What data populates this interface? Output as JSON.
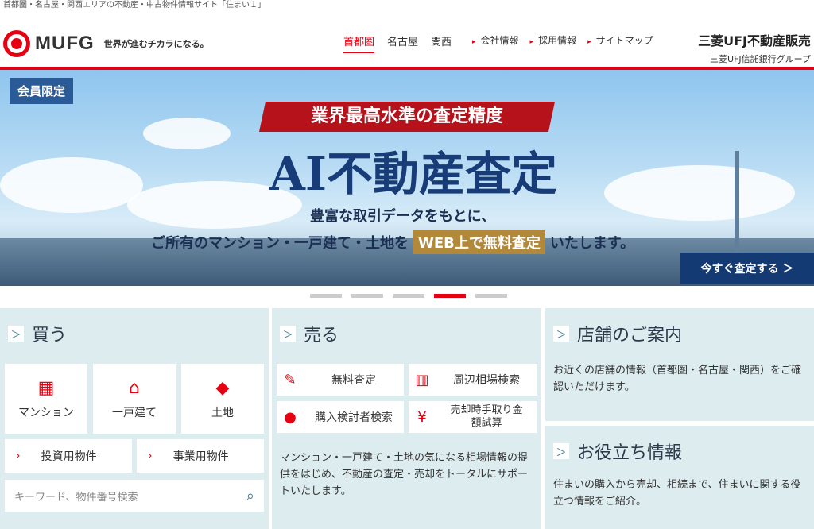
{
  "tagline": "首都圏・名古屋・関西エリアの不動産・中古物件情報サイト「住まい１」",
  "brand": {
    "logo": "MUFG",
    "slogan": "世界が進むチカラになる。"
  },
  "nav": {
    "areas": [
      "首都圏",
      "名古屋",
      "関西"
    ],
    "links": [
      "会社情報",
      "採用情報",
      "サイトマップ"
    ]
  },
  "corp": {
    "name": "三菱UFJ不動産販売",
    "group": "三菱UFJ信託銀行グループ"
  },
  "hero": {
    "badge": "会員限定",
    "ribbon": "業界最高水準の査定精度",
    "headline": "AI不動産査定",
    "line1": "豊富な取引データをもとに、",
    "line2_pre": "ご所有のマンション・一戸建て・土地を",
    "line2_highlight": "WEB上で無料査定",
    "line2_post": "いたします。",
    "cta": "今すぐ査定する ＞"
  },
  "buy": {
    "title": "買う",
    "tiles": [
      "マンション",
      "一戸建て",
      "土地"
    ],
    "rows": [
      "投資用物件",
      "事業用物件"
    ],
    "search_placeholder": "キーワード、物件番号検索"
  },
  "sell": {
    "title": "売る",
    "buttons": [
      "無料査定",
      "周辺相場検索",
      "購入検討者検索",
      "売却時手取り金額試算"
    ],
    "text": "マンション・一戸建て・土地の気になる相場情報の提供をはじめ、不動産の査定・売却をトータルにサポートいたします。"
  },
  "store": {
    "title": "店舗のご案内",
    "text": "お近くの店舗の情報（首都圏・名古屋・関西）をご確認いただけます。"
  },
  "info": {
    "title": "お役立ち情報",
    "text": "住まいの購入から売却、相続まで、住まいに関する役立つ情報をご紹介。"
  },
  "colors": {
    "accent": "#e60012",
    "navy": "#143a74",
    "panel": "#dcecef"
  }
}
